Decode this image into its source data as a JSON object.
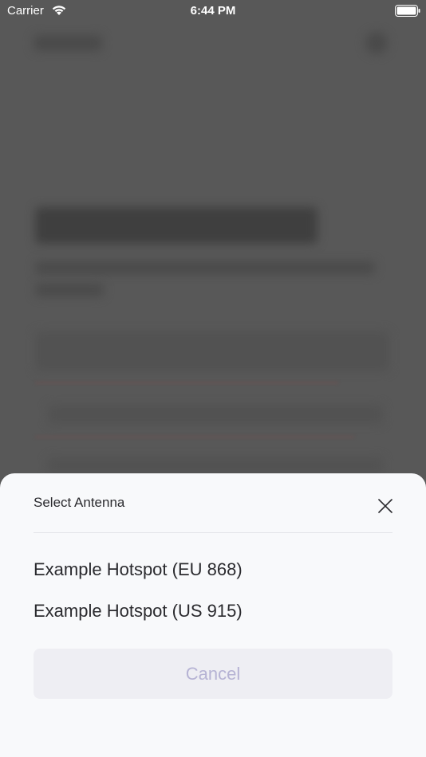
{
  "status_bar": {
    "carrier": "Carrier",
    "time": "6:44 PM",
    "wifi_icon": "wifi-icon",
    "battery_icon": "battery-full-icon"
  },
  "sheet": {
    "title": "Select Antenna",
    "close_icon": "close-icon",
    "options": [
      {
        "label": "Example Hotspot (EU 868)"
      },
      {
        "label": "Example Hotspot (US 915)"
      }
    ],
    "cancel_label": "Cancel"
  },
  "colors": {
    "overlay": "#585858",
    "sheet_background": "#f8f9fb",
    "cancel_text": "#b6b3d4",
    "cancel_background": "#eeeef3"
  }
}
